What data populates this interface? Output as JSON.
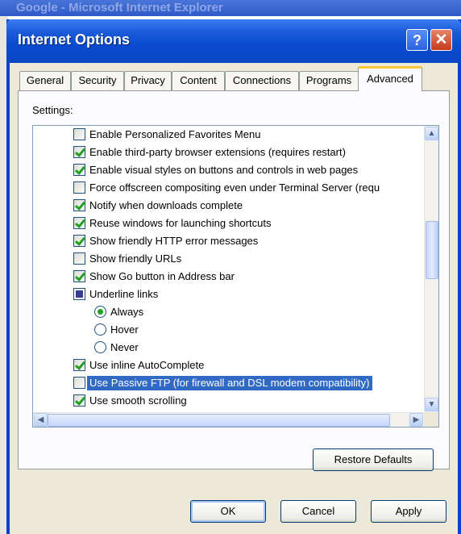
{
  "background_window": {
    "title": "Google - Microsoft Internet Explorer"
  },
  "dialog": {
    "title": "Internet Options",
    "help_button": "?",
    "close_button": "✕"
  },
  "tabs": [
    {
      "label": "General"
    },
    {
      "label": "Security"
    },
    {
      "label": "Privacy"
    },
    {
      "label": "Content"
    },
    {
      "label": "Connections"
    },
    {
      "label": "Programs"
    },
    {
      "label": "Advanced",
      "active": true
    }
  ],
  "settings": {
    "label": "Settings:",
    "items": [
      {
        "type": "checkbox",
        "checked": false,
        "label": "Enable Personalized Favorites Menu"
      },
      {
        "type": "checkbox",
        "checked": true,
        "label": "Enable third-party browser extensions (requires restart)"
      },
      {
        "type": "checkbox",
        "checked": true,
        "label": "Enable visual styles on buttons and controls in web pages"
      },
      {
        "type": "checkbox",
        "checked": false,
        "label": "Force offscreen compositing even under Terminal Server (requ"
      },
      {
        "type": "checkbox",
        "checked": true,
        "label": "Notify when downloads complete"
      },
      {
        "type": "checkbox",
        "checked": true,
        "label": "Reuse windows for launching shortcuts"
      },
      {
        "type": "checkbox",
        "checked": true,
        "label": "Show friendly HTTP error messages"
      },
      {
        "type": "checkbox",
        "checked": false,
        "label": "Show friendly URLs"
      },
      {
        "type": "checkbox",
        "checked": true,
        "label": "Show Go button in Address bar"
      },
      {
        "type": "group",
        "label": "Underline links"
      },
      {
        "type": "radio",
        "selected": true,
        "label": "Always"
      },
      {
        "type": "radio",
        "selected": false,
        "label": "Hover"
      },
      {
        "type": "radio",
        "selected": false,
        "label": "Never"
      },
      {
        "type": "checkbox",
        "checked": true,
        "label": "Use inline AutoComplete"
      },
      {
        "type": "checkbox",
        "checked": false,
        "highlighted": true,
        "label": "Use Passive FTP (for firewall and DSL modem compatibility)"
      },
      {
        "type": "checkbox",
        "checked": true,
        "label": "Use smooth scrolling"
      }
    ]
  },
  "buttons": {
    "restore_defaults": "Restore Defaults",
    "ok": "OK",
    "cancel": "Cancel",
    "apply": "Apply"
  },
  "colors": {
    "title_bar": "#0a4bd0",
    "dialog_bg": "#ece9d8",
    "selection": "#316ac5",
    "check_mark": "#21a121",
    "active_tab_accent": "#ffc83c"
  }
}
